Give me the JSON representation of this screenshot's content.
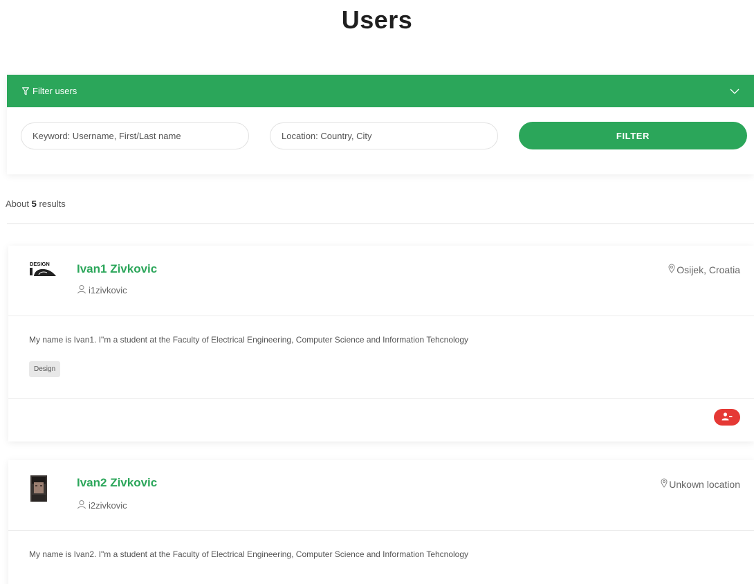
{
  "page": {
    "title": "Users"
  },
  "filter": {
    "header_label": "Filter users",
    "keyword_placeholder": "Keyword: Username, First/Last name",
    "location_placeholder": "Location: Country, City",
    "button_label": "FILTER",
    "accent_color": "#2ba65a"
  },
  "results": {
    "prefix": "About",
    "count": "5",
    "suffix": "results"
  },
  "users": [
    {
      "name": "Ivan1 Zivkovic",
      "username": "i1zivkovic",
      "location": "Osijek, Croatia",
      "bio": "My name is Ivan1. I\"m a student at the Faculty of Electrical Engineering, Computer Science and Information Tehcnology",
      "tags": [
        "Design"
      ],
      "avatar_text": "DESIGN",
      "action_icon": "remove-user-icon",
      "action_color": "#e53935"
    },
    {
      "name": "Ivan2 Zivkovic",
      "username": "i2zivkovic",
      "location": "Unkown location",
      "bio": "My name is Ivan2. I\"m a student at the Faculty of Electrical Engineering, Computer Science and Information Tehcnology"
    }
  ]
}
